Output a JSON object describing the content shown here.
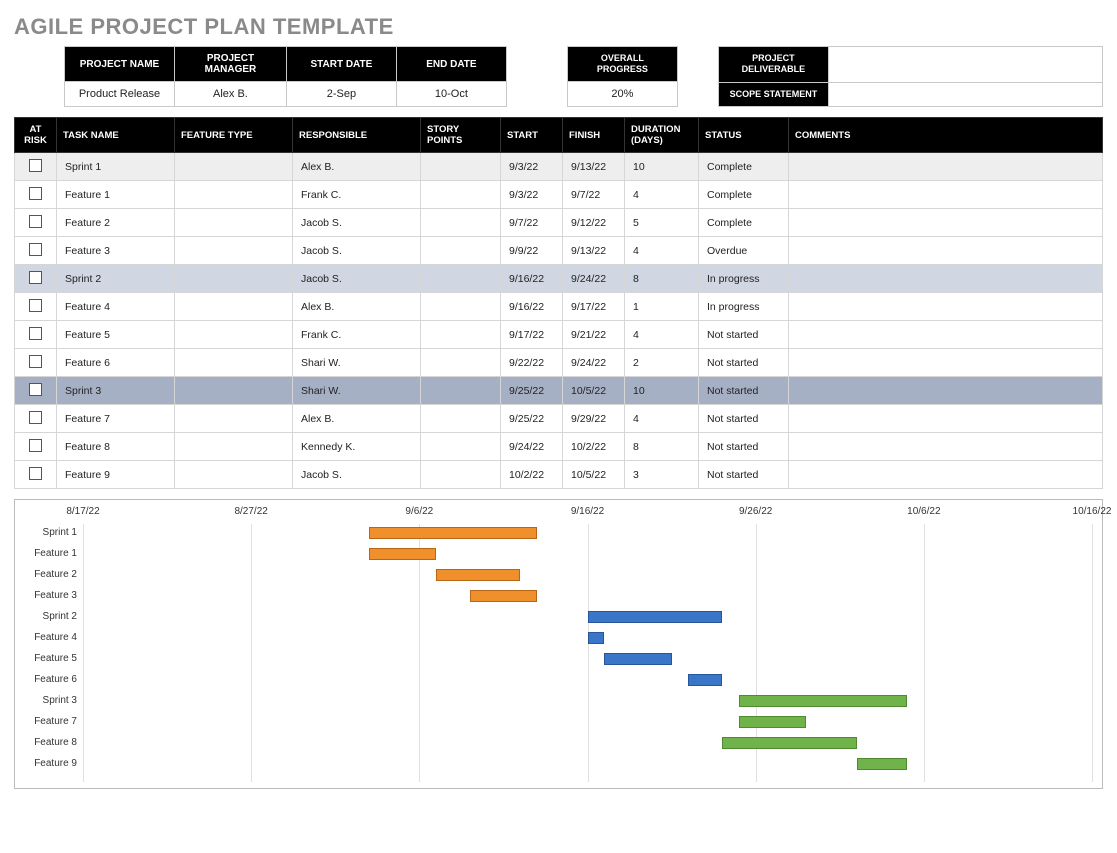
{
  "title": "AGILE PROJECT PLAN TEMPLATE",
  "info_headers": {
    "project_name": "PROJECT NAME",
    "project_manager": "PROJECT MANAGER",
    "start_date": "START DATE",
    "end_date": "END DATE",
    "overall_progress": "OVERALL PROGRESS",
    "project_deliverable": "PROJECT DELIVERABLE",
    "scope_statement": "SCOPE STATEMENT"
  },
  "info_values": {
    "project_name": "Product Release",
    "project_manager": "Alex B.",
    "start_date": "2-Sep",
    "end_date": "10-Oct",
    "overall_progress": "20%",
    "project_deliverable": "",
    "scope_statement": ""
  },
  "columns": {
    "at_risk": "AT RISK",
    "task_name": "TASK NAME",
    "feature_type": "FEATURE TYPE",
    "responsible": "RESPONSIBLE",
    "story_points": "STORY POINTS",
    "start": "START",
    "finish": "FINISH",
    "duration": "DURATION (DAYS)",
    "status": "STATUS",
    "comments": "COMMENTS"
  },
  "rows": [
    {
      "class": "sprint1",
      "task": "Sprint 1",
      "ftype": "",
      "resp": "Alex B.",
      "sp": "",
      "start": "9/3/22",
      "finish": "9/13/22",
      "dur": "10",
      "status": "Complete",
      "com": ""
    },
    {
      "class": "",
      "task": "Feature 1",
      "ftype": "",
      "resp": "Frank C.",
      "sp": "",
      "start": "9/3/22",
      "finish": "9/7/22",
      "dur": "4",
      "status": "Complete",
      "com": ""
    },
    {
      "class": "",
      "task": "Feature 2",
      "ftype": "",
      "resp": "Jacob S.",
      "sp": "",
      "start": "9/7/22",
      "finish": "9/12/22",
      "dur": "5",
      "status": "Complete",
      "com": ""
    },
    {
      "class": "",
      "task": "Feature 3",
      "ftype": "",
      "resp": "Jacob S.",
      "sp": "",
      "start": "9/9/22",
      "finish": "9/13/22",
      "dur": "4",
      "status": "Overdue",
      "com": ""
    },
    {
      "class": "sprint2",
      "task": "Sprint 2",
      "ftype": "",
      "resp": "Jacob S.",
      "sp": "",
      "start": "9/16/22",
      "finish": "9/24/22",
      "dur": "8",
      "status": "In progress",
      "com": ""
    },
    {
      "class": "",
      "task": "Feature 4",
      "ftype": "",
      "resp": "Alex B.",
      "sp": "",
      "start": "9/16/22",
      "finish": "9/17/22",
      "dur": "1",
      "status": "In progress",
      "com": ""
    },
    {
      "class": "",
      "task": "Feature 5",
      "ftype": "",
      "resp": "Frank C.",
      "sp": "",
      "start": "9/17/22",
      "finish": "9/21/22",
      "dur": "4",
      "status": "Not started",
      "com": ""
    },
    {
      "class": "",
      "task": "Feature 6",
      "ftype": "",
      "resp": "Shari W.",
      "sp": "",
      "start": "9/22/22",
      "finish": "9/24/22",
      "dur": "2",
      "status": "Not started",
      "com": ""
    },
    {
      "class": "sprint3",
      "task": "Sprint 3",
      "ftype": "",
      "resp": "Shari W.",
      "sp": "",
      "start": "9/25/22",
      "finish": "10/5/22",
      "dur": "10",
      "status": "Not started",
      "com": ""
    },
    {
      "class": "",
      "task": "Feature 7",
      "ftype": "",
      "resp": "Alex B.",
      "sp": "",
      "start": "9/25/22",
      "finish": "9/29/22",
      "dur": "4",
      "status": "Not started",
      "com": ""
    },
    {
      "class": "",
      "task": "Feature 8",
      "ftype": "",
      "resp": "Kennedy K.",
      "sp": "",
      "start": "9/24/22",
      "finish": "10/2/22",
      "dur": "8",
      "status": "Not started",
      "com": ""
    },
    {
      "class": "",
      "task": "Feature 9",
      "ftype": "",
      "resp": "Jacob S.",
      "sp": "",
      "start": "10/2/22",
      "finish": "10/5/22",
      "dur": "3",
      "status": "Not started",
      "com": ""
    }
  ],
  "chart_data": {
    "type": "gantt",
    "x_axis": {
      "min_date": "8/17/22",
      "max_date": "10/16/22",
      "ticks": [
        "8/17/22",
        "8/27/22",
        "9/6/22",
        "9/16/22",
        "9/26/22",
        "10/6/22",
        "10/16/22"
      ]
    },
    "series": [
      {
        "name": "Sprint 1",
        "start": "9/3/22",
        "end": "9/13/22",
        "color": "orange"
      },
      {
        "name": "Feature 1",
        "start": "9/3/22",
        "end": "9/7/22",
        "color": "orange"
      },
      {
        "name": "Feature 2",
        "start": "9/7/22",
        "end": "9/12/22",
        "color": "orange"
      },
      {
        "name": "Feature 3",
        "start": "9/9/22",
        "end": "9/13/22",
        "color": "orange"
      },
      {
        "name": "Sprint 2",
        "start": "9/16/22",
        "end": "9/24/22",
        "color": "blue"
      },
      {
        "name": "Feature 4",
        "start": "9/16/22",
        "end": "9/17/22",
        "color": "blue"
      },
      {
        "name": "Feature 5",
        "start": "9/17/22",
        "end": "9/21/22",
        "color": "blue"
      },
      {
        "name": "Feature 6",
        "start": "9/22/22",
        "end": "9/24/22",
        "color": "blue"
      },
      {
        "name": "Sprint 3",
        "start": "9/25/22",
        "end": "10/5/22",
        "color": "green"
      },
      {
        "name": "Feature 7",
        "start": "9/25/22",
        "end": "9/29/22",
        "color": "green"
      },
      {
        "name": "Feature 8",
        "start": "9/24/22",
        "end": "10/2/22",
        "color": "green"
      },
      {
        "name": "Feature 9",
        "start": "10/2/22",
        "end": "10/5/22",
        "color": "green"
      }
    ]
  }
}
